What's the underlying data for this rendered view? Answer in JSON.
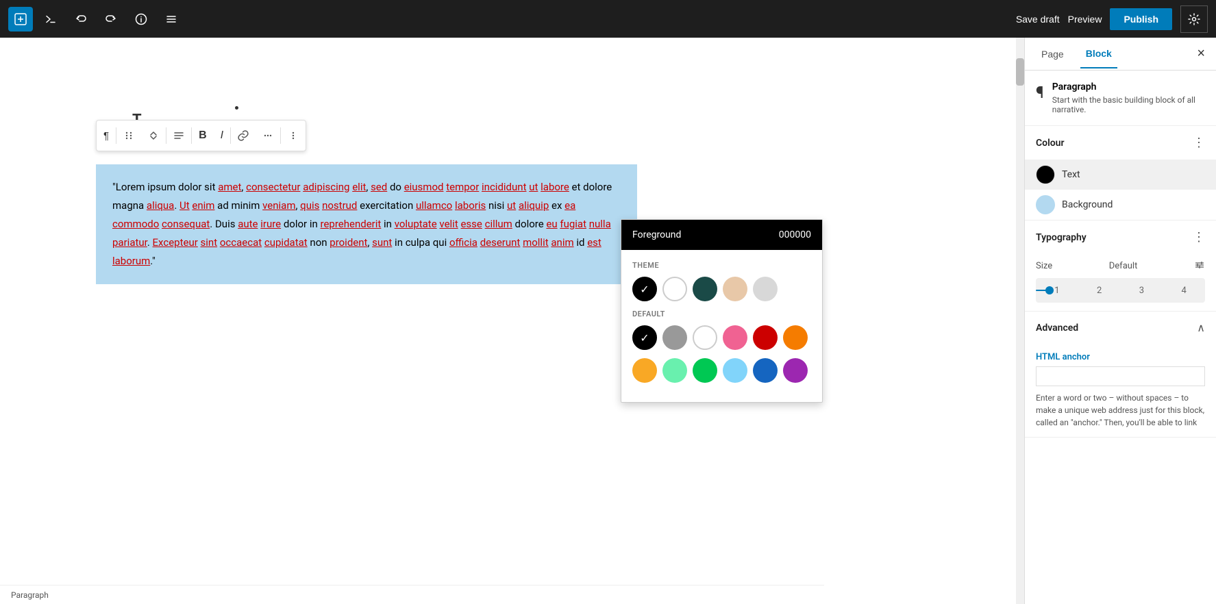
{
  "topbar": {
    "save_draft": "Save draft",
    "preview": "Preview",
    "publish": "Publish"
  },
  "block_toolbar": {
    "bold": "B",
    "italic": "I",
    "more": "⋯"
  },
  "paragraph": {
    "text": "\"Lorem ipsum dolor sit amet, consectetur adipiscing elit, sed do eiusmod tempor incididunt ut labore et dolore magna aliqua. Ut enim ad minim veniam, quis nostrud exercitation ullamco laboris nisi ut aliquip ex ea commodo consequat. Duis aute irure dolor in reprehenderit in voluptate velit esse cillum dolore eu fugiat nulla pariatur. Excepteur sint occaecat cupidatat non proident, sunt in culpa qui officia deserunt mollit anim id est laborum.\""
  },
  "panel": {
    "tab_page": "Page",
    "tab_block": "Block",
    "close_label": "×",
    "block_title": "Paragraph",
    "block_desc": "Start with the basic building block of all narrative."
  },
  "colour_section": {
    "title": "Colour",
    "text_label": "Text",
    "background_label": "Background"
  },
  "typography_section": {
    "title": "Typography",
    "size_label": "Size",
    "size_default": "Default",
    "size_1": "1",
    "size_2": "2",
    "size_3": "3",
    "size_4": "4"
  },
  "advanced_section": {
    "title": "Advanced",
    "html_anchor_label": "HTML anchor",
    "html_anchor_placeholder": "",
    "help_text": "Enter a word or two – without spaces – to make a unique web address just for this block, called an \"anchor.\" Then, you'll be able to link"
  },
  "foreground_popup": {
    "title": "Foreground",
    "value": "000000",
    "theme_label": "THEME",
    "default_label": "DEFAULT"
  },
  "bottom_bar": {
    "status": "Paragraph"
  },
  "theme_colors": [
    {
      "name": "black",
      "hex": "#000000",
      "selected": true
    },
    {
      "name": "white",
      "hex": "#ffffff",
      "selected": false
    },
    {
      "name": "dark-teal",
      "hex": "#1a4a47",
      "selected": false
    },
    {
      "name": "peach",
      "hex": "#e8c8a8",
      "selected": false
    },
    {
      "name": "light-gray",
      "hex": "#d8d8d8",
      "selected": false
    }
  ],
  "default_colors": [
    {
      "name": "black",
      "hex": "#000000",
      "selected": true
    },
    {
      "name": "gray",
      "hex": "#999999",
      "selected": false
    },
    {
      "name": "white",
      "hex": "#ffffff",
      "selected": false
    },
    {
      "name": "pink",
      "hex": "#f06292",
      "selected": false
    },
    {
      "name": "red",
      "hex": "#cc0000",
      "selected": false
    },
    {
      "name": "orange",
      "hex": "#f57c00",
      "selected": false
    },
    {
      "name": "yellow",
      "hex": "#f9a825",
      "selected": false
    },
    {
      "name": "light-green",
      "hex": "#69f0ae",
      "selected": false
    },
    {
      "name": "green",
      "hex": "#00c853",
      "selected": false
    },
    {
      "name": "light-blue",
      "hex": "#81d4fa",
      "selected": false
    },
    {
      "name": "blue",
      "hex": "#1565c0",
      "selected": false
    },
    {
      "name": "purple",
      "hex": "#9c27b0",
      "selected": false
    }
  ]
}
